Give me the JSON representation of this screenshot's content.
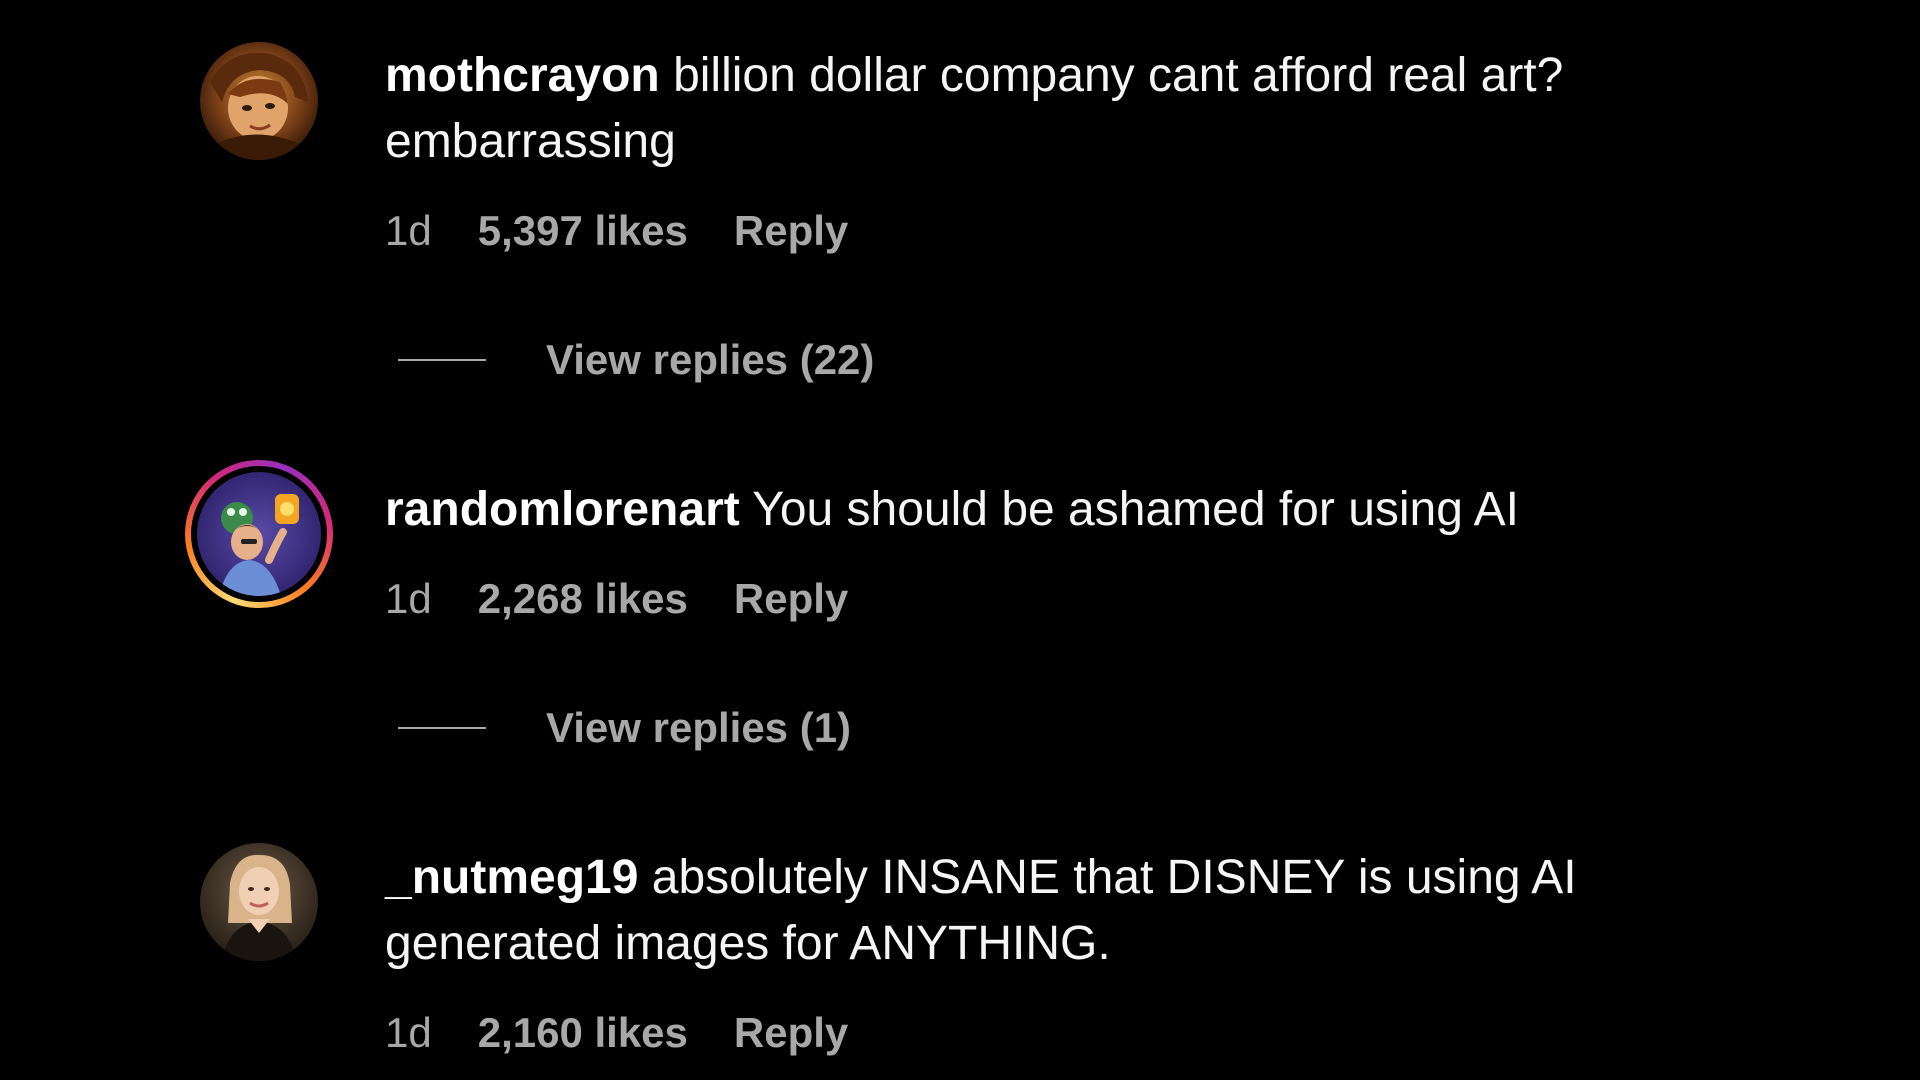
{
  "comments": [
    {
      "username": "mothcrayon",
      "text": "billion dollar company cant afford real art? embarrassing",
      "time": "1d",
      "likes": "5,397 likes",
      "reply_label": "Reply",
      "view_replies": "View replies (22)",
      "has_story": false
    },
    {
      "username": "randomlorenart",
      "text": "You should be ashamed for using AI",
      "time": "1d",
      "likes": "2,268 likes",
      "reply_label": "Reply",
      "view_replies": "View replies (1)",
      "has_story": true
    },
    {
      "username": "_nutmeg19",
      "text": "absolutely INSANE that DISNEY is using AI generated images for ANYTHING.",
      "time": "1d",
      "likes": "2,160 likes",
      "reply_label": "Reply",
      "has_story": false
    }
  ],
  "colors": {
    "background": "#000000",
    "primary_text": "#f5f5f5",
    "secondary_text": "#a8a8a8",
    "story_ring": [
      "#feda75",
      "#fa7e1e",
      "#d62976",
      "#962fbf"
    ]
  }
}
